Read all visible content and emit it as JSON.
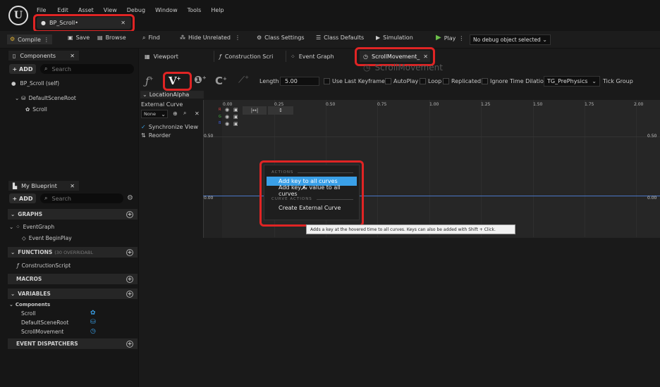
{
  "menubar": {
    "items": [
      "File",
      "Edit",
      "Asset",
      "View",
      "Debug",
      "Window",
      "Tools",
      "Help"
    ]
  },
  "doc_tab": {
    "title": "BP_Scroll•"
  },
  "toolbar": {
    "compile": "Compile",
    "save": "Save",
    "browse": "Browse",
    "find": "Find",
    "hide_unrelated": "Hide Unrelated",
    "class_settings": "Class Settings",
    "class_defaults": "Class Defaults",
    "simulation": "Simulation",
    "play": "Play",
    "debug_object": "No debug object selected"
  },
  "components": {
    "title": "Components",
    "add": "+ ADD",
    "search_placeholder": "Search",
    "self": "BP_Scroll (self)",
    "root": "DefaultSceneRoot",
    "child": "Scroll"
  },
  "my_blueprint": {
    "title": "My Blueprint",
    "add": "+ ADD",
    "search_placeholder": "Search",
    "graphs": "GRAPHS",
    "event_graph": "EventGraph",
    "begin_play": "Event BeginPlay",
    "functions": "FUNCTIONS",
    "functions_note": "(30 OVERRIDABL",
    "construction_script": "ConstructionScript",
    "macros": "MACROS",
    "variables": "VARIABLES",
    "components_group": "Components",
    "vars": [
      "Scroll",
      "DefaultSceneRoot",
      "ScrollMovement"
    ],
    "event_dispatchers": "EVENT DISPATCHERS"
  },
  "editor_tabs": [
    "Viewport",
    "Construction Scri",
    "Event Graph",
    "ScrollMovement_"
  ],
  "timeline": {
    "title": "ScrollMovement",
    "length_label": "Length",
    "length_value": "5.00",
    "use_last_keyframe": "Use Last Keyframe",
    "autoplay": "AutoPlay",
    "loop": "Loop",
    "replicated": "Replicated",
    "ignore_time_dilation": "Ignore Time Dilation",
    "tick_group_value": "TG_PrePhysics",
    "tick_group_label": "Tick Group",
    "track_name": "LocationAlpha",
    "external_curve": "External Curve",
    "none": "None",
    "sync_view": "Synchronize View",
    "reorder": "Reorder",
    "ticks": [
      "0.00",
      "0.25",
      "0.50",
      "0.75",
      "1.00",
      "1.25",
      "1.50",
      "1.75",
      "2.00"
    ],
    "y_top": "0.50",
    "y_mid": "0.00",
    "y_top_right": "0.50",
    "y_mid_right": "0.00",
    "channels": [
      "R",
      "G",
      "B"
    ]
  },
  "context_menu": {
    "actions_header": "ACTIONS",
    "add_key": "Add key to all curves",
    "add_key_value": "Add key & value to all curves",
    "curve_actions_header": "CURVE ACTIONS",
    "create_external": "Create External Curve"
  },
  "tooltip": "Adds a key at the hovered time to all curves.  Keys can also be added with Shift + Click.",
  "colors": {
    "accent_blue": "#3aa0e8",
    "highlight_red": "#e02424",
    "play_green": "#6cc04a",
    "curve_line": "#4a78c8"
  }
}
